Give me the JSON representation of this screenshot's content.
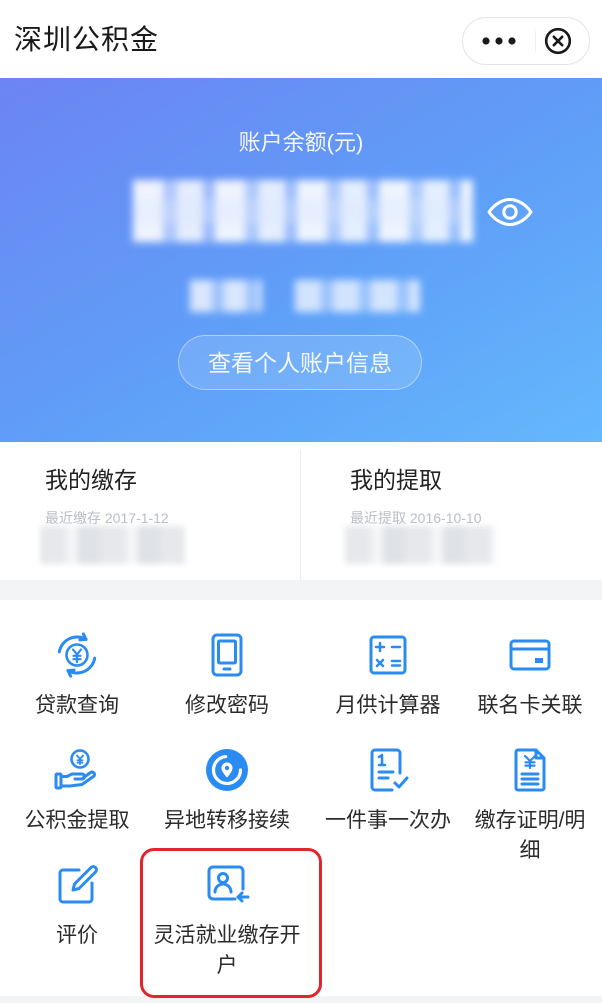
{
  "colors": {
    "accent": "#2a8bf2",
    "hero_start": "#6c84f2",
    "hero_end": "#64b8fc",
    "highlight": "#e0262a"
  },
  "header": {
    "title": "深圳公积金",
    "more_icon": "more-dots-icon",
    "close_icon": "close-circle-icon"
  },
  "account": {
    "balance_label": "账户余额(元)",
    "visibility_icon": "eye-icon",
    "view_button": "查看个人账户信息"
  },
  "summary": [
    {
      "title": "我的缴存",
      "subtitle": "最近缴存 2017-1-12"
    },
    {
      "title": "我的提取",
      "subtitle": "最近提取 2016-10-10"
    }
  ],
  "services": [
    {
      "label": "贷款查询",
      "icon": "loan-query-icon"
    },
    {
      "label": "修改密码",
      "icon": "tablet-icon"
    },
    {
      "label": "月供计算器",
      "icon": "calculator-icon"
    },
    {
      "label": "联名卡关联",
      "icon": "bank-card-icon"
    },
    {
      "label": "公积金提取",
      "icon": "hand-coin-icon"
    },
    {
      "label": "异地转移接续",
      "icon": "transfer-location-icon"
    },
    {
      "label": "一件事一次办",
      "icon": "checklist-document-icon"
    },
    {
      "label": "缴存证明/明细",
      "icon": "yen-document-icon"
    },
    {
      "label": "评价",
      "icon": "edit-icon"
    },
    {
      "label": "灵活就业缴存开户",
      "icon": "id-card-person-icon",
      "highlighted": true
    }
  ]
}
